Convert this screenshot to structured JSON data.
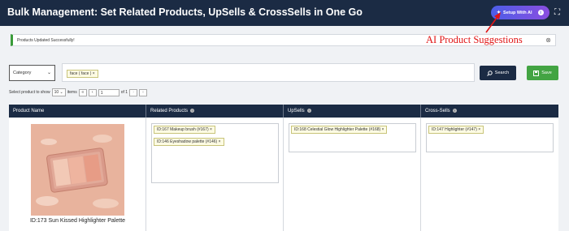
{
  "header": {
    "title": "Bulk Management: Set Related Products, UpSells & CrossSells in One Go",
    "ai_button_label": "Setup With AI",
    "ai_button_icon": "sparkle-icon",
    "info_icon": "info-icon",
    "expand_icon": "fullscreen-icon"
  },
  "notice": {
    "text": "Products Updated Successfully!",
    "close_icon": "close-icon"
  },
  "annotation": {
    "text": "AI Product Suggestions",
    "color": "#e01515"
  },
  "filters": {
    "category_label": "Category",
    "tags": [
      "face ( face ) ×"
    ],
    "search_label": "Search",
    "save_label": "Save"
  },
  "pagination": {
    "prefix": "Select product to show",
    "per_page": "10",
    "suffix": "items",
    "first": "«",
    "prev": "‹",
    "page": "1",
    "of_label": "of 1",
    "next": "›",
    "last": "»"
  },
  "table": {
    "headers": {
      "product_name": "Product Name",
      "related": "Related Products",
      "upsells": "UpSells",
      "crosssells": "Cross-Sells"
    },
    "rows": [
      {
        "product_label": "ID:173 Sun Kissed Highlighter Palette",
        "related": [
          "ID:167 Makeup brush (#167) ×",
          "ID:146 Eyeshadow palette (#146) ×"
        ],
        "upsells": [
          "ID:168 Celestial Glow Highlighter Palette (#168) ×"
        ],
        "crosssells": [
          "ID:147 Highlighter (#147) ×"
        ]
      }
    ]
  },
  "colors": {
    "header_bg": "#1b2b44",
    "save_green": "#43a443",
    "ai_gradient_start": "#4c5ee8",
    "ai_gradient_end": "#8a4ee0",
    "success_border": "#3a9b3a"
  }
}
